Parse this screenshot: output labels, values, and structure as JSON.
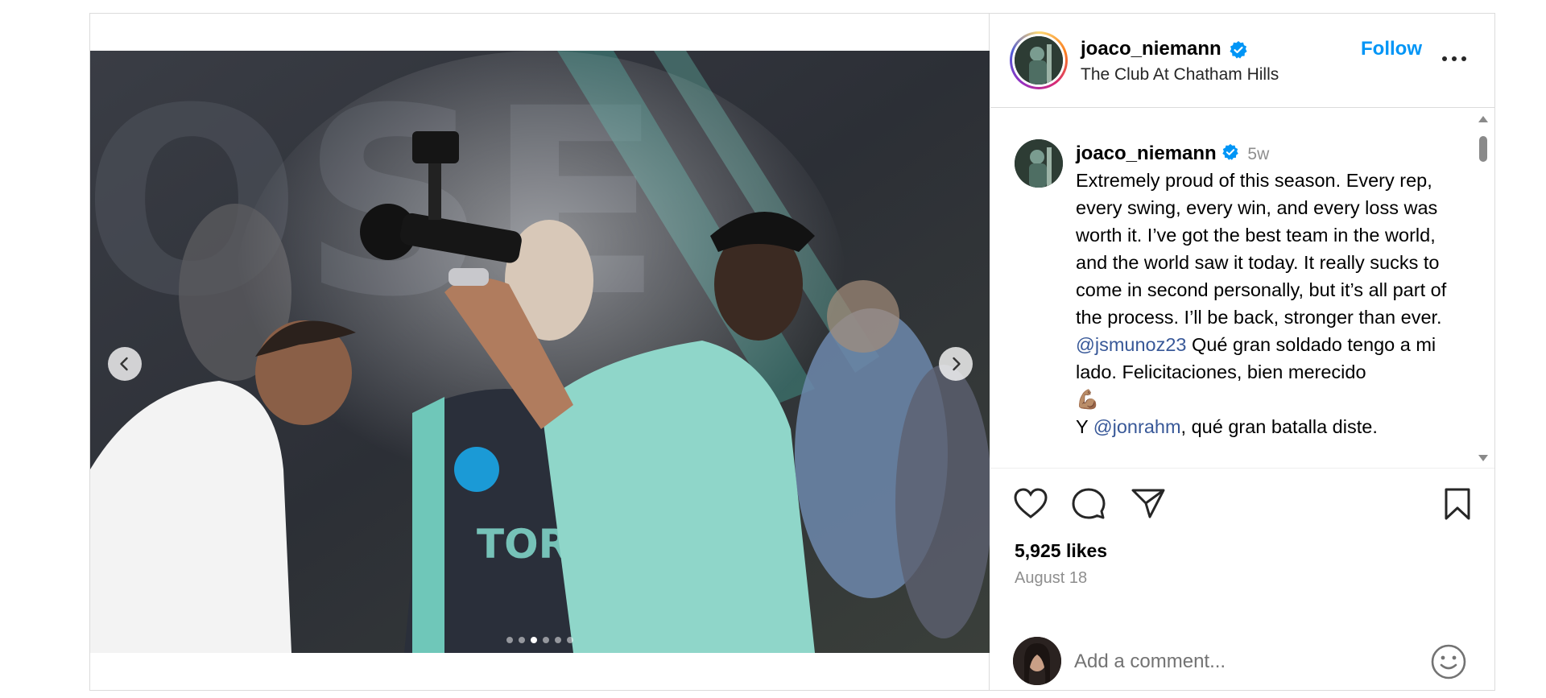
{
  "header": {
    "username": "joaco_niemann",
    "location": "The Club At Chatham Hills",
    "follow_label": "Follow",
    "more_icon": "more-horizontal-icon"
  },
  "caption": {
    "username": "joaco_niemann",
    "time_ago": "5w",
    "line1": "Extremely proud of this season. Every rep, every swing, every win, and every loss was worth it. I’ve got the best team in the world, and the world saw it today. It really sucks to come in second personally, but it’s all part of the process. I’ll be back, stronger than ever.",
    "mention1": "@jsmunoz23",
    "line2": " Qué gran soldado tengo a mi lado. Felicitaciones, bien merecido",
    "emoji": "💪🏽",
    "line3_prefix": "Y ",
    "mention2": "@jonrahm",
    "line3": ", qué gran batalla diste."
  },
  "stats": {
    "likes": "5,925 likes",
    "date": "August 18"
  },
  "comment": {
    "placeholder": "Add a comment..."
  },
  "carousel": {
    "slide_count": 6,
    "active_index": 2
  },
  "colors": {
    "accent": "#0095f6",
    "verified": "#0095f6",
    "mention": "#385898",
    "border": "#dbdbdb"
  }
}
